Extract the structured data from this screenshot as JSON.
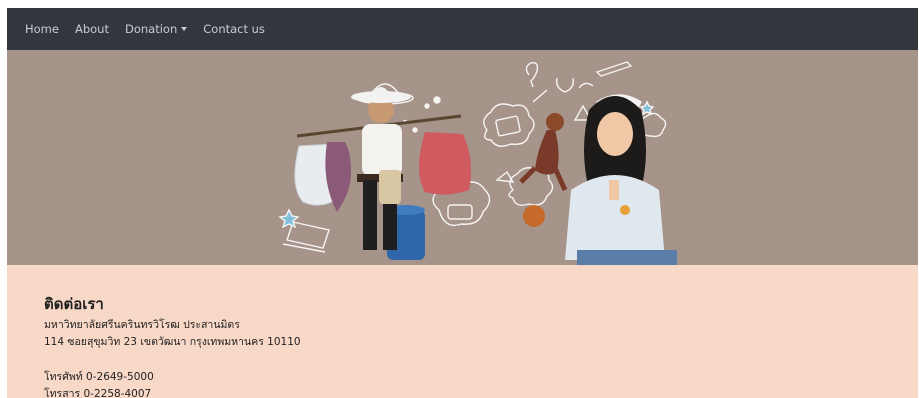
{
  "nav": {
    "items": [
      {
        "label": "Home"
      },
      {
        "label": "About"
      },
      {
        "label": "Donation"
      },
      {
        "label": "Contact us"
      }
    ]
  },
  "colors": {
    "navbar": "#33373d",
    "banner": "#a69389",
    "content": "#f8d8c7"
  },
  "contact": {
    "title": "ติดต่อเรา",
    "org": "มหาวิทยาลัยศรีนครินทรวิโรฒ ประสานมิตร",
    "address": "114 ซอยสุขุมวิท 23 เขตวัฒนา กรุงเทพมหานคร 10110",
    "phone": "โทรศัพท์ 0-2649-5000",
    "fax": "โทรสาร 0-2258-4007"
  }
}
